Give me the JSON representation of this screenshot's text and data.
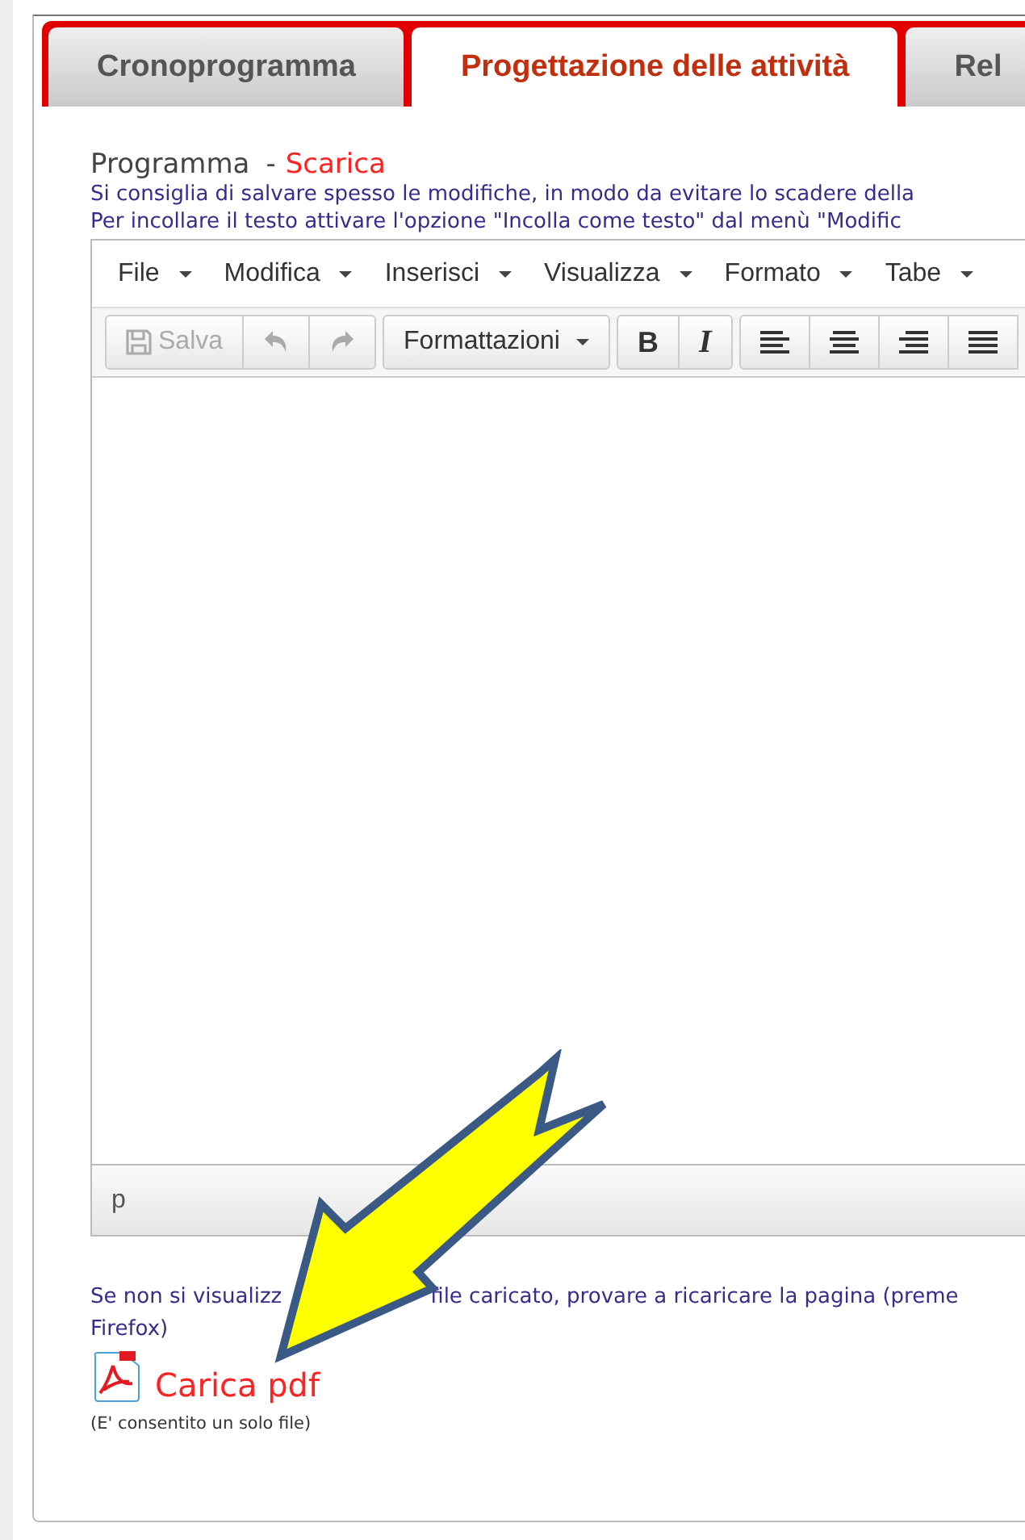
{
  "tabs": [
    {
      "label": "Cronoprogramma",
      "selected": false
    },
    {
      "label": "Progettazione delle attività",
      "selected": true
    },
    {
      "label": "Rel",
      "selected": false
    }
  ],
  "section": {
    "title": "Programma",
    "separator": "-",
    "link": "Scarica"
  },
  "hints": [
    "Si consiglia di salvare spesso le modifiche, in modo da evitare lo scadere della",
    "Per incollare il testo attivare l'opzione \"Incolla come testo\" dal menù \"Modific"
  ],
  "editor": {
    "menu": [
      "File",
      "Modifica",
      "Inserisci",
      "Visualizza",
      "Formato",
      "Tabe"
    ],
    "toolbar": [
      {
        "kind": "save",
        "label": "Salva",
        "disabled": true
      },
      {
        "kind": "undo",
        "disabled": true
      },
      {
        "kind": "redo",
        "disabled": true
      },
      {
        "kind": "dropdown",
        "label": "Formattazioni",
        "disabled": false
      },
      {
        "kind": "bold",
        "label": "B",
        "disabled": false
      },
      {
        "kind": "italic",
        "label": "I",
        "disabled": false
      },
      {
        "kind": "align-left",
        "disabled": false
      },
      {
        "kind": "align-center",
        "disabled": false
      },
      {
        "kind": "align-right",
        "disabled": false
      },
      {
        "kind": "justify",
        "disabled": false
      }
    ],
    "status_path": "p"
  },
  "notice": {
    "before_arrow": "Se non si visualizz",
    "after_arrow": "file caricato, provare a ricaricare la pagina (preme",
    "line_2": "Firefox)"
  },
  "upload": {
    "label": "Carica pdf",
    "note": "(E' consentito un solo file)"
  }
}
